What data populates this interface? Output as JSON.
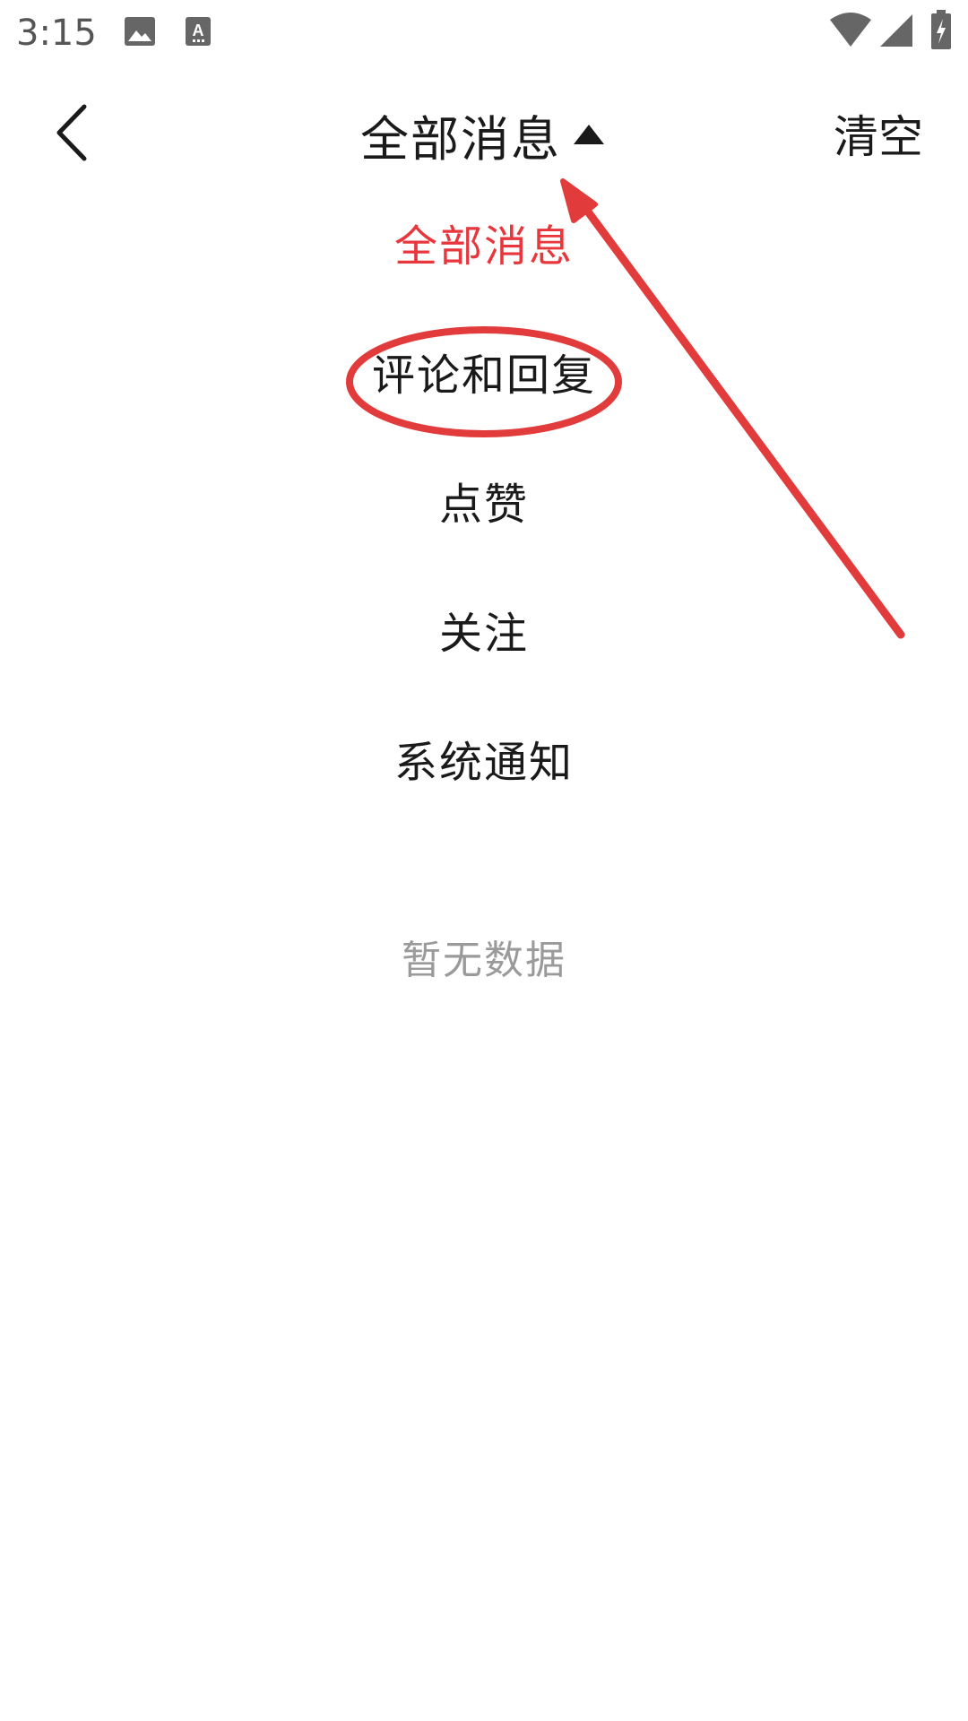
{
  "status_bar": {
    "time": "3:15",
    "icons": [
      "image-icon",
      "text-icon",
      "wifi-icon",
      "signal-icon",
      "battery-charging-icon"
    ]
  },
  "header": {
    "back_icon": "chevron-left-icon",
    "title": "全部消息",
    "title_caret_icon": "caret-up-icon",
    "clear_label": "清空"
  },
  "menu": {
    "items": [
      {
        "label": "全部消息",
        "active": true
      },
      {
        "label": "评论和回复",
        "active": false
      },
      {
        "label": "点赞",
        "active": false
      },
      {
        "label": "关注",
        "active": false
      },
      {
        "label": "系统通知",
        "active": false
      }
    ]
  },
  "empty_state": {
    "text": "暂无数据"
  },
  "colors": {
    "accent": "#e8363d",
    "text": "#1a1a1a",
    "muted": "#9a9a9a",
    "annotation": "#e23b3b"
  }
}
